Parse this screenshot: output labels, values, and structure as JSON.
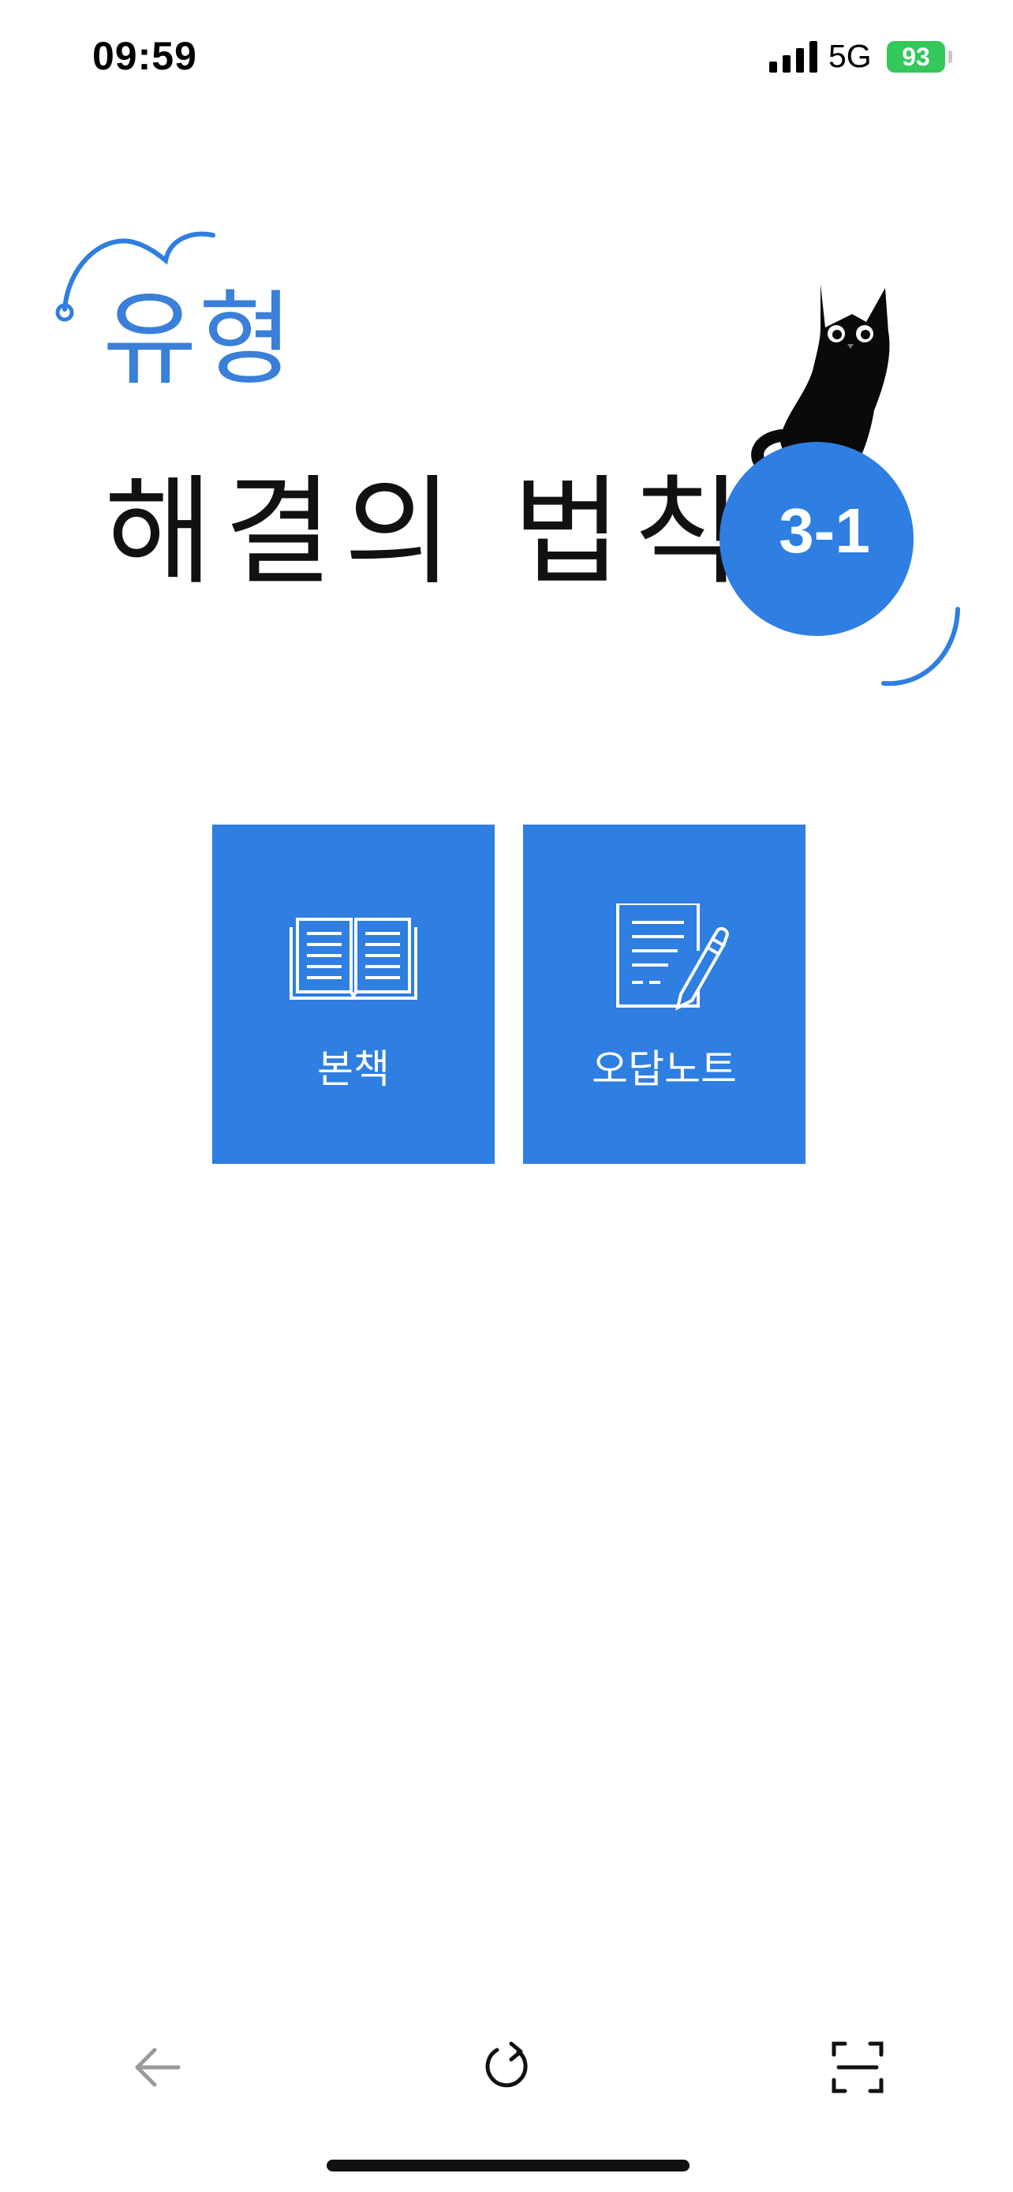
{
  "status_bar": {
    "time": "09:59",
    "network": "5G",
    "battery": "93"
  },
  "logo": {
    "top_text": "유형",
    "main_text": "해결의 법칙",
    "badge": "3-1",
    "accent_color": "#2f7ee1"
  },
  "menu": {
    "book": {
      "label": "본책",
      "icon": "open-book-icon"
    },
    "notes": {
      "label": "오답노트",
      "icon": "note-pencil-icon"
    }
  },
  "toolbar": {
    "back_icon": "arrow-left-icon",
    "reload_icon": "reload-icon",
    "scan_icon": "scan-frame-icon"
  }
}
